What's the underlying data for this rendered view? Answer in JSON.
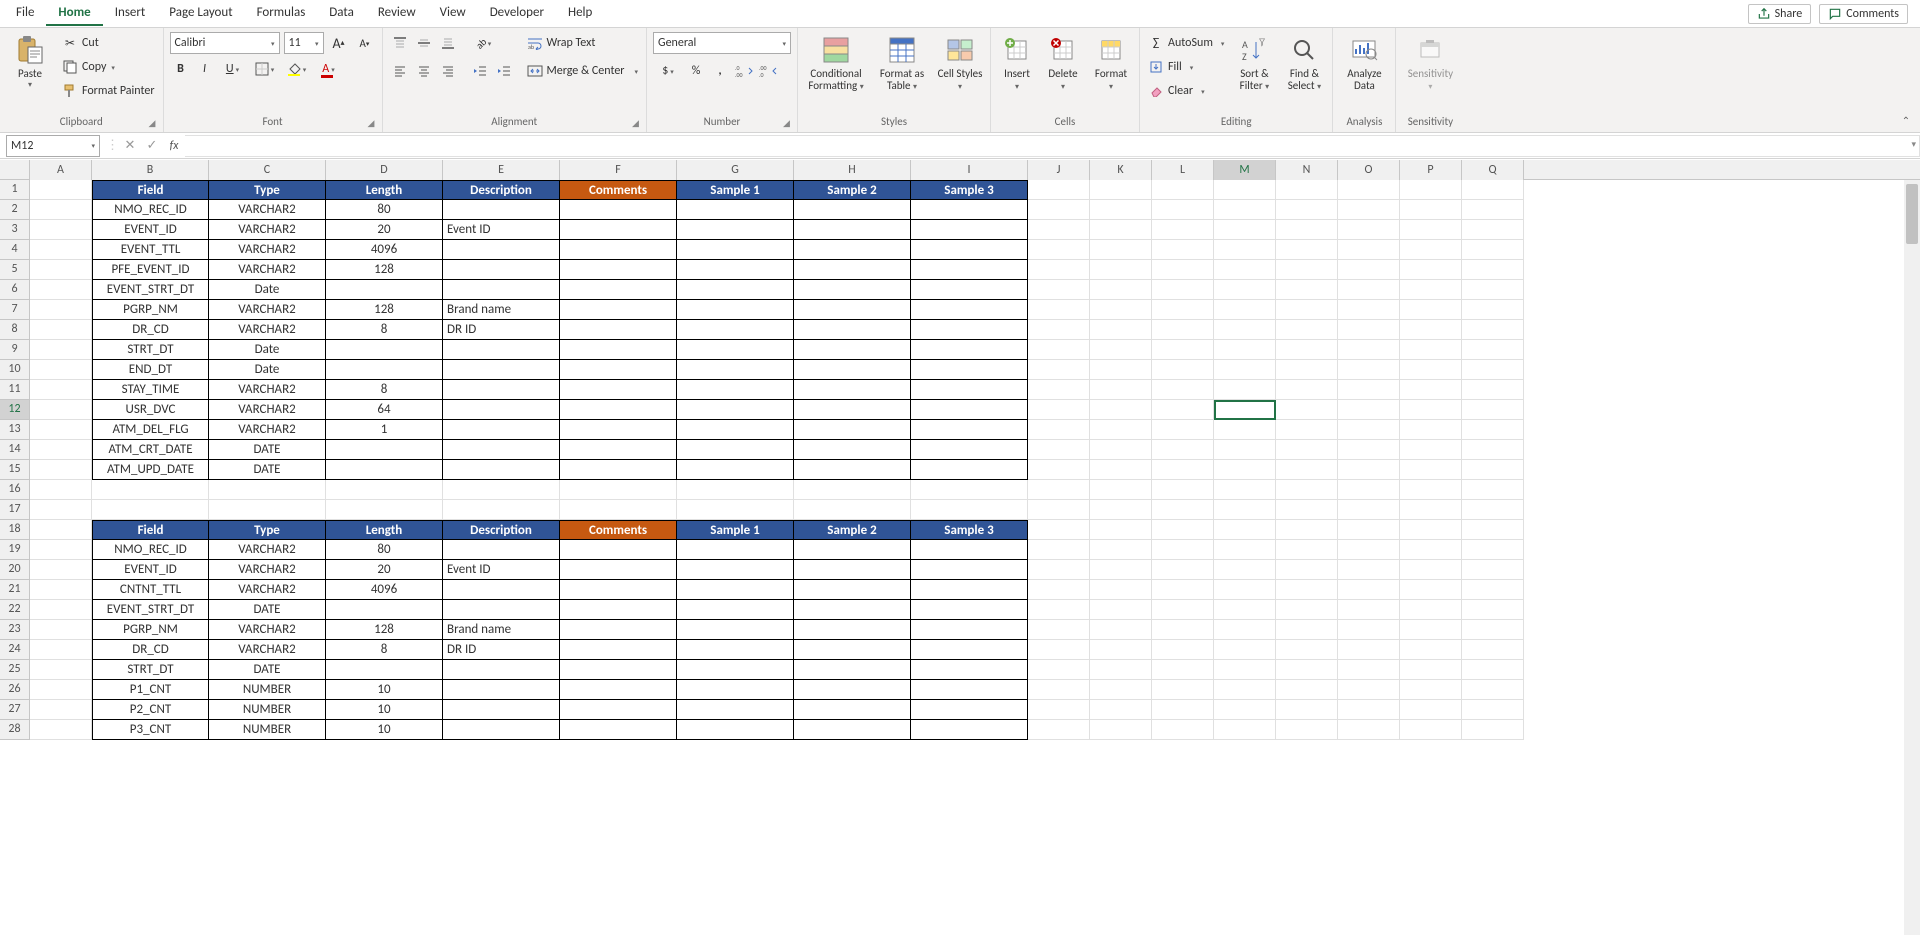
{
  "tabs": [
    "File",
    "Home",
    "Insert",
    "Page Layout",
    "Formulas",
    "Data",
    "Review",
    "View",
    "Developer",
    "Help"
  ],
  "activeTab": "Home",
  "share": "Share",
  "comments": "Comments",
  "ribbon": {
    "clipboard": {
      "paste": "Paste",
      "cut": "Cut",
      "copy": "Copy",
      "formatPainter": "Format Painter",
      "label": "Clipboard"
    },
    "font": {
      "name": "Calibri",
      "size": "11",
      "label": "Font"
    },
    "alignment": {
      "wrap": "Wrap Text",
      "merge": "Merge & Center",
      "label": "Alignment"
    },
    "number": {
      "format": "General",
      "label": "Number"
    },
    "styles": {
      "cond": "Conditional Formatting",
      "fmtas": "Format as Table",
      "cellStyles": "Cell Styles",
      "label": "Styles"
    },
    "cells": {
      "insert": "Insert",
      "delete": "Delete",
      "format": "Format",
      "label": "Cells"
    },
    "editing": {
      "autosum": "AutoSum",
      "fill": "Fill",
      "clear": "Clear",
      "sort": "Sort & Filter",
      "find": "Find & Select",
      "label": "Editing"
    },
    "analysis": {
      "analyze": "Analyze Data",
      "label": "Analysis"
    },
    "sensitivity": {
      "btn": "Sensitivity",
      "label": "Sensitivity"
    }
  },
  "nameBox": "M12",
  "formula": "",
  "colWidths": {
    "A": 62,
    "B": 117,
    "C": 117,
    "D": 117,
    "E": 117,
    "F": 117,
    "G": 117,
    "H": 117,
    "I": 117,
    "J": 62,
    "K": 62,
    "L": 62,
    "M": 62,
    "N": 62,
    "O": 62,
    "P": 62,
    "Q": 62
  },
  "columns": [
    "A",
    "B",
    "C",
    "D",
    "E",
    "F",
    "G",
    "H",
    "I",
    "J",
    "K",
    "L",
    "M",
    "N",
    "O",
    "P",
    "Q"
  ],
  "numRows": 28,
  "activeCell": {
    "col": "M",
    "row": 12
  },
  "sheet": {
    "1": {
      "B": {
        "v": "Field",
        "s": "hb"
      },
      "C": {
        "v": "Type",
        "s": "hb"
      },
      "D": {
        "v": "Length",
        "s": "hb"
      },
      "E": {
        "v": "Description",
        "s": "hb"
      },
      "F": {
        "v": "Comments",
        "s": "ho"
      },
      "G": {
        "v": "Sample 1",
        "s": "hb"
      },
      "H": {
        "v": "Sample 2",
        "s": "hb"
      },
      "I": {
        "v": "Sample 3",
        "s": "hb"
      }
    },
    "2": {
      "B": {
        "v": "NMO_REC_ID",
        "s": "tc"
      },
      "C": {
        "v": "VARCHAR2",
        "s": "tc"
      },
      "D": {
        "v": "80",
        "s": "tc"
      },
      "E": {
        "v": "",
        "s": "t"
      },
      "F": {
        "v": "",
        "s": "t"
      },
      "G": {
        "v": "",
        "s": "t"
      },
      "H": {
        "v": "",
        "s": "t"
      },
      "I": {
        "v": "",
        "s": "t"
      }
    },
    "3": {
      "B": {
        "v": "EVENT_ID",
        "s": "tc"
      },
      "C": {
        "v": "VARCHAR2",
        "s": "tc"
      },
      "D": {
        "v": "20",
        "s": "tc"
      },
      "E": {
        "v": "Event ID",
        "s": "t"
      },
      "F": {
        "v": "",
        "s": "t"
      },
      "G": {
        "v": "",
        "s": "t"
      },
      "H": {
        "v": "",
        "s": "t"
      },
      "I": {
        "v": "",
        "s": "t"
      }
    },
    "4": {
      "B": {
        "v": "EVENT_TTL",
        "s": "tc"
      },
      "C": {
        "v": "VARCHAR2",
        "s": "tc"
      },
      "D": {
        "v": "4096",
        "s": "tc"
      },
      "E": {
        "v": "",
        "s": "t"
      },
      "F": {
        "v": "",
        "s": "t"
      },
      "G": {
        "v": "",
        "s": "t"
      },
      "H": {
        "v": "",
        "s": "t"
      },
      "I": {
        "v": "",
        "s": "t"
      }
    },
    "5": {
      "B": {
        "v": "PFE_EVENT_ID",
        "s": "tc"
      },
      "C": {
        "v": "VARCHAR2",
        "s": "tc"
      },
      "D": {
        "v": "128",
        "s": "tc"
      },
      "E": {
        "v": "",
        "s": "t"
      },
      "F": {
        "v": "",
        "s": "t"
      },
      "G": {
        "v": "",
        "s": "t"
      },
      "H": {
        "v": "",
        "s": "t"
      },
      "I": {
        "v": "",
        "s": "t"
      }
    },
    "6": {
      "B": {
        "v": "EVENT_STRT_DT",
        "s": "tc"
      },
      "C": {
        "v": "Date",
        "s": "tc"
      },
      "D": {
        "v": "",
        "s": "tc"
      },
      "E": {
        "v": "",
        "s": "t"
      },
      "F": {
        "v": "",
        "s": "t"
      },
      "G": {
        "v": "",
        "s": "t"
      },
      "H": {
        "v": "",
        "s": "t"
      },
      "I": {
        "v": "",
        "s": "t"
      }
    },
    "7": {
      "B": {
        "v": "PGRP_NM",
        "s": "tc"
      },
      "C": {
        "v": "VARCHAR2",
        "s": "tc"
      },
      "D": {
        "v": "128",
        "s": "tc"
      },
      "E": {
        "v": "Brand name",
        "s": "t"
      },
      "F": {
        "v": "",
        "s": "t"
      },
      "G": {
        "v": "",
        "s": "t"
      },
      "H": {
        "v": "",
        "s": "t"
      },
      "I": {
        "v": "",
        "s": "t"
      }
    },
    "8": {
      "B": {
        "v": "DR_CD",
        "s": "tc"
      },
      "C": {
        "v": "VARCHAR2",
        "s": "tc"
      },
      "D": {
        "v": "8",
        "s": "tc"
      },
      "E": {
        "v": "DR ID",
        "s": "t"
      },
      "F": {
        "v": "",
        "s": "t"
      },
      "G": {
        "v": "",
        "s": "t"
      },
      "H": {
        "v": "",
        "s": "t"
      },
      "I": {
        "v": "",
        "s": "t"
      }
    },
    "9": {
      "B": {
        "v": "STRT_DT",
        "s": "tc"
      },
      "C": {
        "v": "Date",
        "s": "tc"
      },
      "D": {
        "v": "",
        "s": "tc"
      },
      "E": {
        "v": "",
        "s": "t"
      },
      "F": {
        "v": "",
        "s": "t"
      },
      "G": {
        "v": "",
        "s": "t"
      },
      "H": {
        "v": "",
        "s": "t"
      },
      "I": {
        "v": "",
        "s": "t"
      }
    },
    "10": {
      "B": {
        "v": "END_DT",
        "s": "tc"
      },
      "C": {
        "v": "Date",
        "s": "tc"
      },
      "D": {
        "v": "",
        "s": "tc"
      },
      "E": {
        "v": "",
        "s": "t"
      },
      "F": {
        "v": "",
        "s": "t"
      },
      "G": {
        "v": "",
        "s": "t"
      },
      "H": {
        "v": "",
        "s": "t"
      },
      "I": {
        "v": "",
        "s": "t"
      }
    },
    "11": {
      "B": {
        "v": "STAY_TIME",
        "s": "tc"
      },
      "C": {
        "v": "VARCHAR2",
        "s": "tc"
      },
      "D": {
        "v": "8",
        "s": "tc"
      },
      "E": {
        "v": "",
        "s": "t"
      },
      "F": {
        "v": "",
        "s": "t"
      },
      "G": {
        "v": "",
        "s": "t"
      },
      "H": {
        "v": "",
        "s": "t"
      },
      "I": {
        "v": "",
        "s": "t"
      }
    },
    "12": {
      "B": {
        "v": "USR_DVC",
        "s": "tc"
      },
      "C": {
        "v": "VARCHAR2",
        "s": "tc"
      },
      "D": {
        "v": "64",
        "s": "tc"
      },
      "E": {
        "v": "",
        "s": "t"
      },
      "F": {
        "v": "",
        "s": "t"
      },
      "G": {
        "v": "",
        "s": "t"
      },
      "H": {
        "v": "",
        "s": "t"
      },
      "I": {
        "v": "",
        "s": "t"
      }
    },
    "13": {
      "B": {
        "v": "ATM_DEL_FLG",
        "s": "tc"
      },
      "C": {
        "v": "VARCHAR2",
        "s": "tc"
      },
      "D": {
        "v": "1",
        "s": "tc"
      },
      "E": {
        "v": "",
        "s": "t"
      },
      "F": {
        "v": "",
        "s": "t"
      },
      "G": {
        "v": "",
        "s": "t"
      },
      "H": {
        "v": "",
        "s": "t"
      },
      "I": {
        "v": "",
        "s": "t"
      }
    },
    "14": {
      "B": {
        "v": "ATM_CRT_DATE",
        "s": "tc"
      },
      "C": {
        "v": "DATE",
        "s": "tc"
      },
      "D": {
        "v": "",
        "s": "tc"
      },
      "E": {
        "v": "",
        "s": "t"
      },
      "F": {
        "v": "",
        "s": "t"
      },
      "G": {
        "v": "",
        "s": "t"
      },
      "H": {
        "v": "",
        "s": "t"
      },
      "I": {
        "v": "",
        "s": "t"
      }
    },
    "15": {
      "B": {
        "v": "ATM_UPD_DATE",
        "s": "tc"
      },
      "C": {
        "v": "DATE",
        "s": "tc"
      },
      "D": {
        "v": "",
        "s": "tc"
      },
      "E": {
        "v": "",
        "s": "t"
      },
      "F": {
        "v": "",
        "s": "t"
      },
      "G": {
        "v": "",
        "s": "t"
      },
      "H": {
        "v": "",
        "s": "t"
      },
      "I": {
        "v": "",
        "s": "t"
      }
    },
    "18": {
      "B": {
        "v": "Field",
        "s": "hb"
      },
      "C": {
        "v": "Type",
        "s": "hb"
      },
      "D": {
        "v": "Length",
        "s": "hb"
      },
      "E": {
        "v": "Description",
        "s": "hb"
      },
      "F": {
        "v": "Comments",
        "s": "ho"
      },
      "G": {
        "v": "Sample 1",
        "s": "hb"
      },
      "H": {
        "v": "Sample 2",
        "s": "hb"
      },
      "I": {
        "v": "Sample 3",
        "s": "hb"
      }
    },
    "19": {
      "B": {
        "v": "NMO_REC_ID",
        "s": "tc"
      },
      "C": {
        "v": "VARCHAR2",
        "s": "tc"
      },
      "D": {
        "v": "80",
        "s": "tc"
      },
      "E": {
        "v": "",
        "s": "t"
      },
      "F": {
        "v": "",
        "s": "t"
      },
      "G": {
        "v": "",
        "s": "t"
      },
      "H": {
        "v": "",
        "s": "t"
      },
      "I": {
        "v": "",
        "s": "t"
      }
    },
    "20": {
      "B": {
        "v": "EVENT_ID",
        "s": "tc"
      },
      "C": {
        "v": "VARCHAR2",
        "s": "tc"
      },
      "D": {
        "v": "20",
        "s": "tc"
      },
      "E": {
        "v": "Event ID",
        "s": "t"
      },
      "F": {
        "v": "",
        "s": "t"
      },
      "G": {
        "v": "",
        "s": "t"
      },
      "H": {
        "v": "",
        "s": "t"
      },
      "I": {
        "v": "",
        "s": "t"
      }
    },
    "21": {
      "B": {
        "v": "CNTNT_TTL",
        "s": "tc"
      },
      "C": {
        "v": "VARCHAR2",
        "s": "tc"
      },
      "D": {
        "v": "4096",
        "s": "tc"
      },
      "E": {
        "v": "",
        "s": "t"
      },
      "F": {
        "v": "",
        "s": "t"
      },
      "G": {
        "v": "",
        "s": "t"
      },
      "H": {
        "v": "",
        "s": "t"
      },
      "I": {
        "v": "",
        "s": "t"
      }
    },
    "22": {
      "B": {
        "v": "EVENT_STRT_DT",
        "s": "tc"
      },
      "C": {
        "v": "DATE",
        "s": "tc"
      },
      "D": {
        "v": "",
        "s": "tc"
      },
      "E": {
        "v": "",
        "s": "t"
      },
      "F": {
        "v": "",
        "s": "t"
      },
      "G": {
        "v": "",
        "s": "t"
      },
      "H": {
        "v": "",
        "s": "t"
      },
      "I": {
        "v": "",
        "s": "t"
      }
    },
    "23": {
      "B": {
        "v": "PGRP_NM",
        "s": "tc"
      },
      "C": {
        "v": "VARCHAR2",
        "s": "tc"
      },
      "D": {
        "v": "128",
        "s": "tc"
      },
      "E": {
        "v": "Brand name",
        "s": "t"
      },
      "F": {
        "v": "",
        "s": "t"
      },
      "G": {
        "v": "",
        "s": "t"
      },
      "H": {
        "v": "",
        "s": "t"
      },
      "I": {
        "v": "",
        "s": "t"
      }
    },
    "24": {
      "B": {
        "v": "DR_CD",
        "s": "tc"
      },
      "C": {
        "v": "VARCHAR2",
        "s": "tc"
      },
      "D": {
        "v": "8",
        "s": "tc"
      },
      "E": {
        "v": "DR ID",
        "s": "t"
      },
      "F": {
        "v": "",
        "s": "t"
      },
      "G": {
        "v": "",
        "s": "t"
      },
      "H": {
        "v": "",
        "s": "t"
      },
      "I": {
        "v": "",
        "s": "t"
      }
    },
    "25": {
      "B": {
        "v": "STRT_DT",
        "s": "tc"
      },
      "C": {
        "v": "DATE",
        "s": "tc"
      },
      "D": {
        "v": "",
        "s": "tc"
      },
      "E": {
        "v": "",
        "s": "t"
      },
      "F": {
        "v": "",
        "s": "t"
      },
      "G": {
        "v": "",
        "s": "t"
      },
      "H": {
        "v": "",
        "s": "t"
      },
      "I": {
        "v": "",
        "s": "t"
      }
    },
    "26": {
      "B": {
        "v": "P1_CNT",
        "s": "tc"
      },
      "C": {
        "v": "NUMBER",
        "s": "tc"
      },
      "D": {
        "v": "10",
        "s": "tc"
      },
      "E": {
        "v": "",
        "s": "t"
      },
      "F": {
        "v": "",
        "s": "t"
      },
      "G": {
        "v": "",
        "s": "t"
      },
      "H": {
        "v": "",
        "s": "t"
      },
      "I": {
        "v": "",
        "s": "t"
      }
    },
    "27": {
      "B": {
        "v": "P2_CNT",
        "s": "tc"
      },
      "C": {
        "v": "NUMBER",
        "s": "tc"
      },
      "D": {
        "v": "10",
        "s": "tc"
      },
      "E": {
        "v": "",
        "s": "t"
      },
      "F": {
        "v": "",
        "s": "t"
      },
      "G": {
        "v": "",
        "s": "t"
      },
      "H": {
        "v": "",
        "s": "t"
      },
      "I": {
        "v": "",
        "s": "t"
      }
    },
    "28": {
      "B": {
        "v": "P3_CNT",
        "s": "tc"
      },
      "C": {
        "v": "NUMBER",
        "s": "tc"
      },
      "D": {
        "v": "10",
        "s": "tc"
      },
      "E": {
        "v": "",
        "s": "t"
      },
      "F": {
        "v": "",
        "s": "t"
      },
      "G": {
        "v": "",
        "s": "t"
      },
      "H": {
        "v": "",
        "s": "t"
      },
      "I": {
        "v": "",
        "s": "t"
      }
    }
  }
}
